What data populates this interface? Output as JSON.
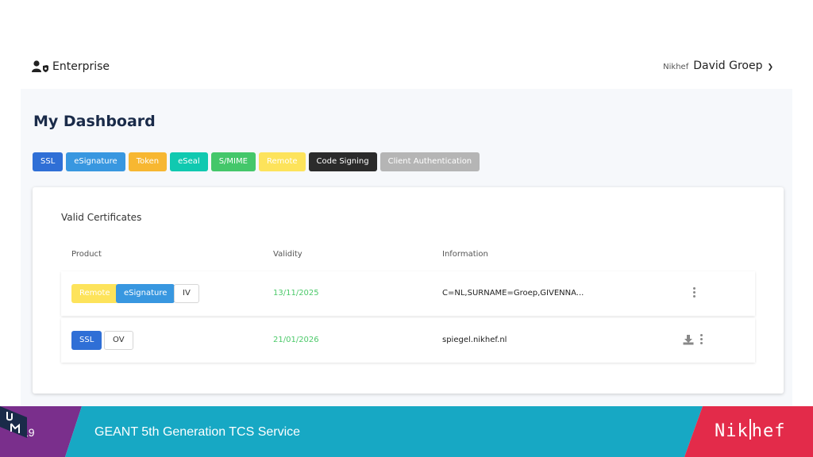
{
  "header": {
    "brand_label": "Enterprise",
    "org": "Nikhef",
    "user_name": "David Groep"
  },
  "dashboard": {
    "title": "My Dashboard",
    "chips": [
      {
        "label": "SSL",
        "color": "#2f6fd6"
      },
      {
        "label": "eSignature",
        "color": "#3897e0"
      },
      {
        "label": "Token",
        "color": "#f7b731"
      },
      {
        "label": "eSeal",
        "color": "#10c9b0"
      },
      {
        "label": "S/MIME",
        "color": "#44c76a"
      },
      {
        "label": "Remote",
        "color": "#fde35b"
      },
      {
        "label": "Code Signing",
        "color": "#2b2b2b"
      },
      {
        "label": "Client Authentication",
        "color": "#b5b5b5"
      }
    ]
  },
  "certificates": {
    "title": "Valid Certificates",
    "columns": {
      "product": "Product",
      "validity": "Validity",
      "information": "Information"
    },
    "rows": [
      {
        "tags": [
          {
            "label": "Remote",
            "color": "#fde35b"
          },
          {
            "label": "eSignature",
            "color": "#3897e0"
          },
          {
            "label": "IV",
            "color": "#ffffff"
          }
        ],
        "validity": "13/11/2025",
        "information": "C=NL,SURNAME=Groep,GIVENNA...",
        "actions": [
          "more-vertical-icon"
        ]
      },
      {
        "tags": [
          {
            "label": "SSL",
            "color": "#2f6fd6"
          },
          {
            "label": "OV",
            "color": "#ffffff"
          }
        ],
        "validity": "21/01/2026",
        "information": "spiegel.nikhef.nl",
        "actions": [
          "download-icon",
          "more-vertical-icon"
        ]
      }
    ]
  },
  "footer": {
    "slide_number": "19",
    "title": "GEANT 5th Generation TCS Service",
    "colors": {
      "purple": "#7a2f8c",
      "teal": "#17a8c4",
      "red": "#e32b4a"
    }
  }
}
